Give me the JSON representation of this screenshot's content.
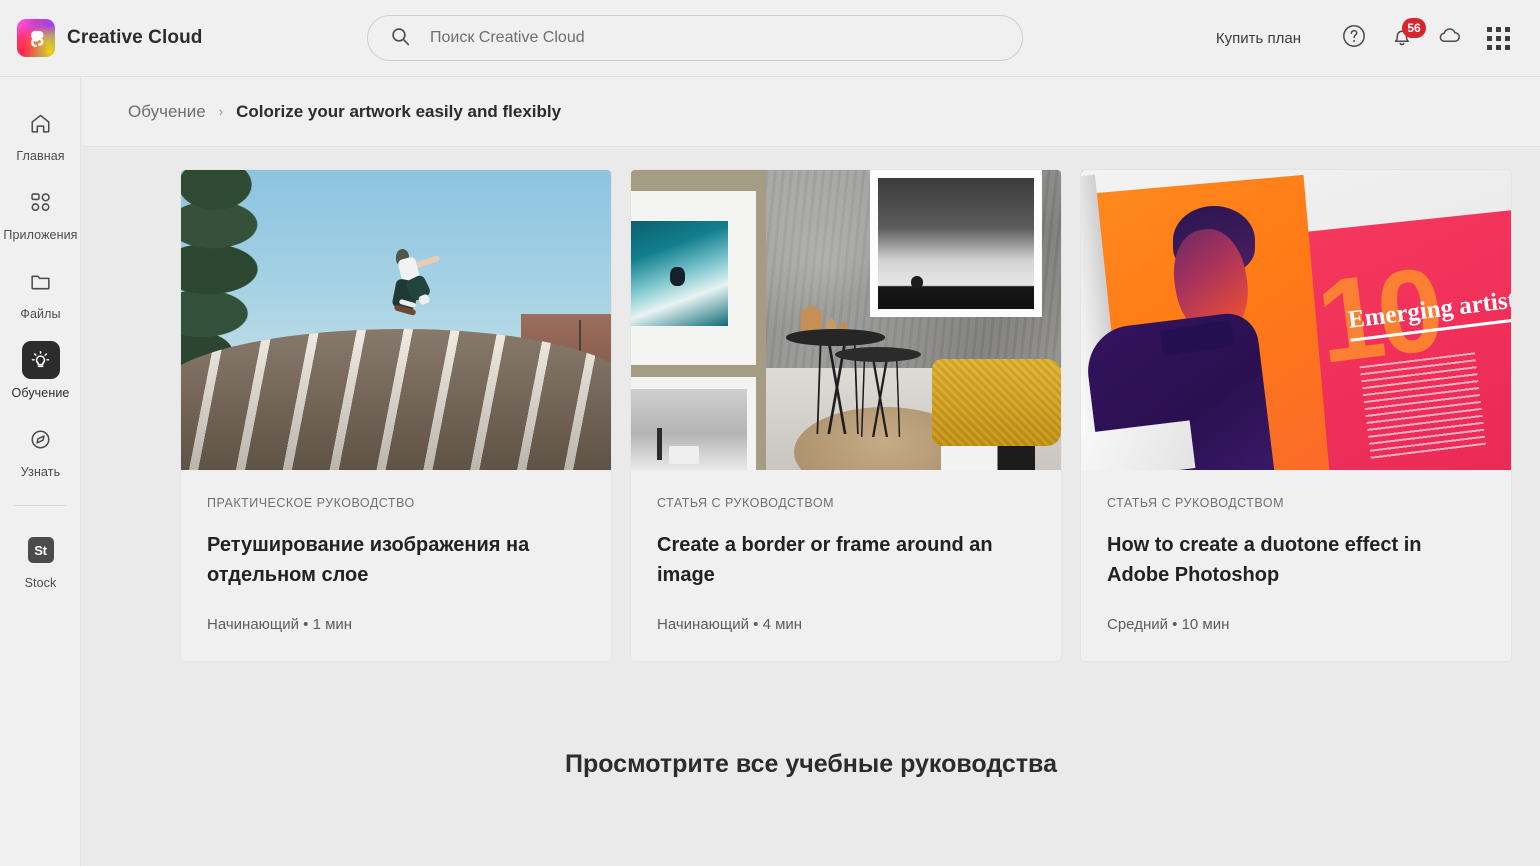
{
  "header": {
    "brand_name": "Creative Cloud",
    "logo_icon": "creative-cloud-logo",
    "search": {
      "placeholder": "Поиск Creative Cloud",
      "value": "",
      "icon": "search-icon"
    },
    "buy_plan_label": "Купить план",
    "help_icon": "question-circle-icon",
    "notifications_icon": "bell-icon",
    "notifications_count": "56",
    "cloud_icon": "cloud-icon",
    "app_grid_icon": "grid-apps-icon"
  },
  "sidebar": {
    "items": [
      {
        "label": "Главная",
        "icon": "home-icon",
        "active": false
      },
      {
        "label": "Приложения",
        "icon": "apps-icon",
        "active": false
      },
      {
        "label": "Файлы",
        "icon": "folder-icon",
        "active": false
      },
      {
        "label": "Обучение",
        "icon": "lightbulb-icon",
        "active": true
      },
      {
        "label": "Узнать",
        "icon": "compass-icon",
        "active": false
      }
    ],
    "stock": {
      "label": "Stock",
      "glyph": "St",
      "icon": "adobe-stock-icon"
    }
  },
  "breadcrumb": {
    "root": "Обучение",
    "separator": "›",
    "current": "Colorize your artwork easily and flexibly"
  },
  "cards": [
    {
      "kicker": "ПРАКТИЧЕСКОЕ РУКОВОДСТВО",
      "title": "Ретуширование изображения на отдельном слое",
      "meta": "Начинающий • 1 мин",
      "media": "skateboarder-over-striped-ramp"
    },
    {
      "kicker": "СТАТЬЯ С РУКОВОДСТВОМ",
      "title": "Create a border or frame around an image",
      "meta": "Начинающий • 4 мин",
      "media": "interior-with-framed-prints"
    },
    {
      "kicker": "СТАТЬЯ С РУКОВОДСТВОМ",
      "title": "How to create a duotone effect in Adobe Photoshop",
      "meta": "Средний • 10 мин",
      "media": "magazine-duotone-portrait"
    }
  ],
  "magazine_art": {
    "number": "10",
    "headline": "Emerging artists"
  },
  "footer": {
    "heading": "Просмотрите все учебные руководства"
  },
  "colors": {
    "page_bg": "#eaeaea",
    "chrome_bg": "#f0f0f0",
    "border": "#e2e2e2",
    "text_primary": "#2c2c2c",
    "text_secondary": "#6e6e6e",
    "badge_red": "#d7252c",
    "active_nav": "#2c2c2c"
  }
}
